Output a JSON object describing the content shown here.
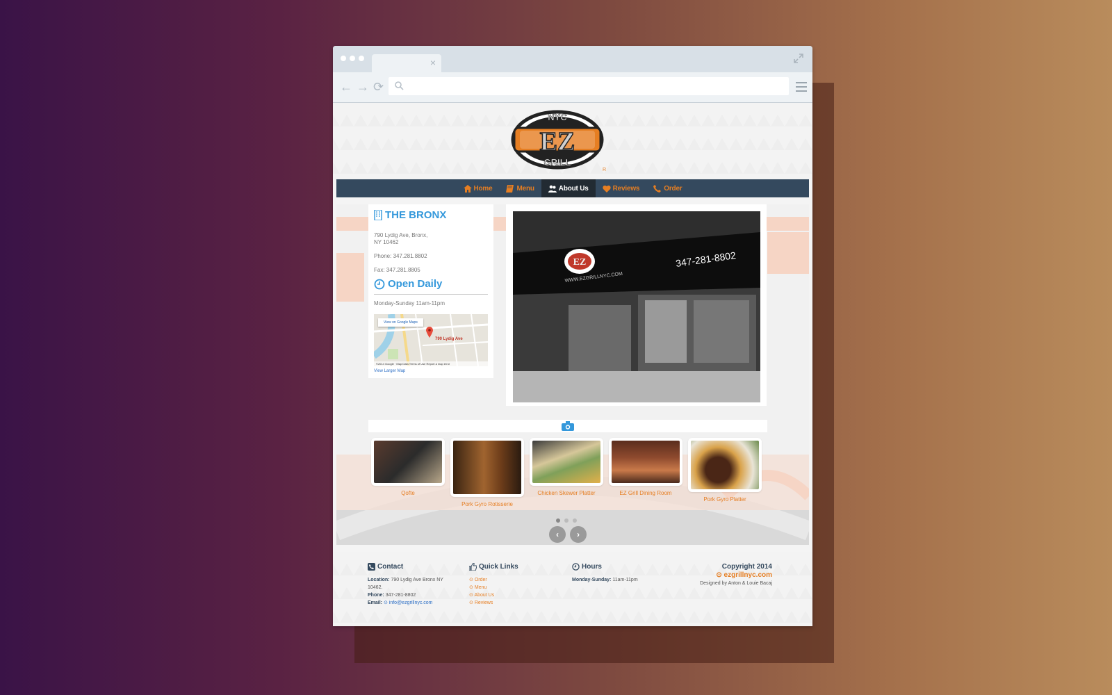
{
  "brand": {
    "logo_top": "NYC",
    "logo_main": "EZ",
    "logo_bottom": "GRILL",
    "logo_reg": "R",
    "accent": "#e67e22",
    "blue": "#3498db",
    "navy": "#34495e"
  },
  "nav": [
    {
      "label": "Home",
      "icon": "home-icon"
    },
    {
      "label": "Menu",
      "icon": "book-icon"
    },
    {
      "label": "About Us",
      "icon": "users-icon",
      "active": true
    },
    {
      "label": "Reviews",
      "icon": "heart-icon"
    },
    {
      "label": "Order",
      "icon": "phone-icon"
    }
  ],
  "location": {
    "title": "THE BRONX",
    "address_line1": "790 Lydig Ave, Bronx,",
    "address_line2": "NY 10462",
    "phone_label": "Phone:",
    "phone": "347.281.8802",
    "fax_label": "Fax:",
    "fax": "347.281.8805",
    "open_title": "Open Daily",
    "hours": "Monday-Sunday 11am-11pm",
    "map_button": "View on Google Maps",
    "map_pin_label": "790 Lydig Ave",
    "map_footer": "©2014 Google · Map Data   Terms of Use   Report a map error",
    "map_link": "View Larger Map"
  },
  "storefront": {
    "phone_sign": "347-281-8802",
    "web_sign": "WWW.EZGRILLNYC.COM"
  },
  "gallery": [
    {
      "caption": "Qofte"
    },
    {
      "caption": "Pork Gyro Rotisserie"
    },
    {
      "caption": "Chicken Skewer Platter"
    },
    {
      "caption": "EZ Grill Dining Room"
    },
    {
      "caption": "Pork Gyro Platter"
    }
  ],
  "carousel": {
    "pages": 3,
    "current": 1,
    "prev": "‹",
    "next": "›"
  },
  "footer": {
    "contact_title": "Contact",
    "location_label": "Location:",
    "location_value": "790 Lydig Ave Bronx NY 10462.",
    "phone_label": "Phone:",
    "phone_value": "347-281-8802",
    "email_label": "Email:",
    "email_value": "info@ezgrillnyc.com",
    "quick_title": "Quick Links",
    "quick_links": [
      "Order",
      "Menu",
      "About Us",
      "Reviews"
    ],
    "hours_title": "Hours",
    "hours_label": "Monday-Sunday:",
    "hours_value": "11am-11pm",
    "copyright": "Copyright 2014",
    "site": "ezgrillnyc.com",
    "designed": "Designed by Anton & Louie Bacaj"
  }
}
